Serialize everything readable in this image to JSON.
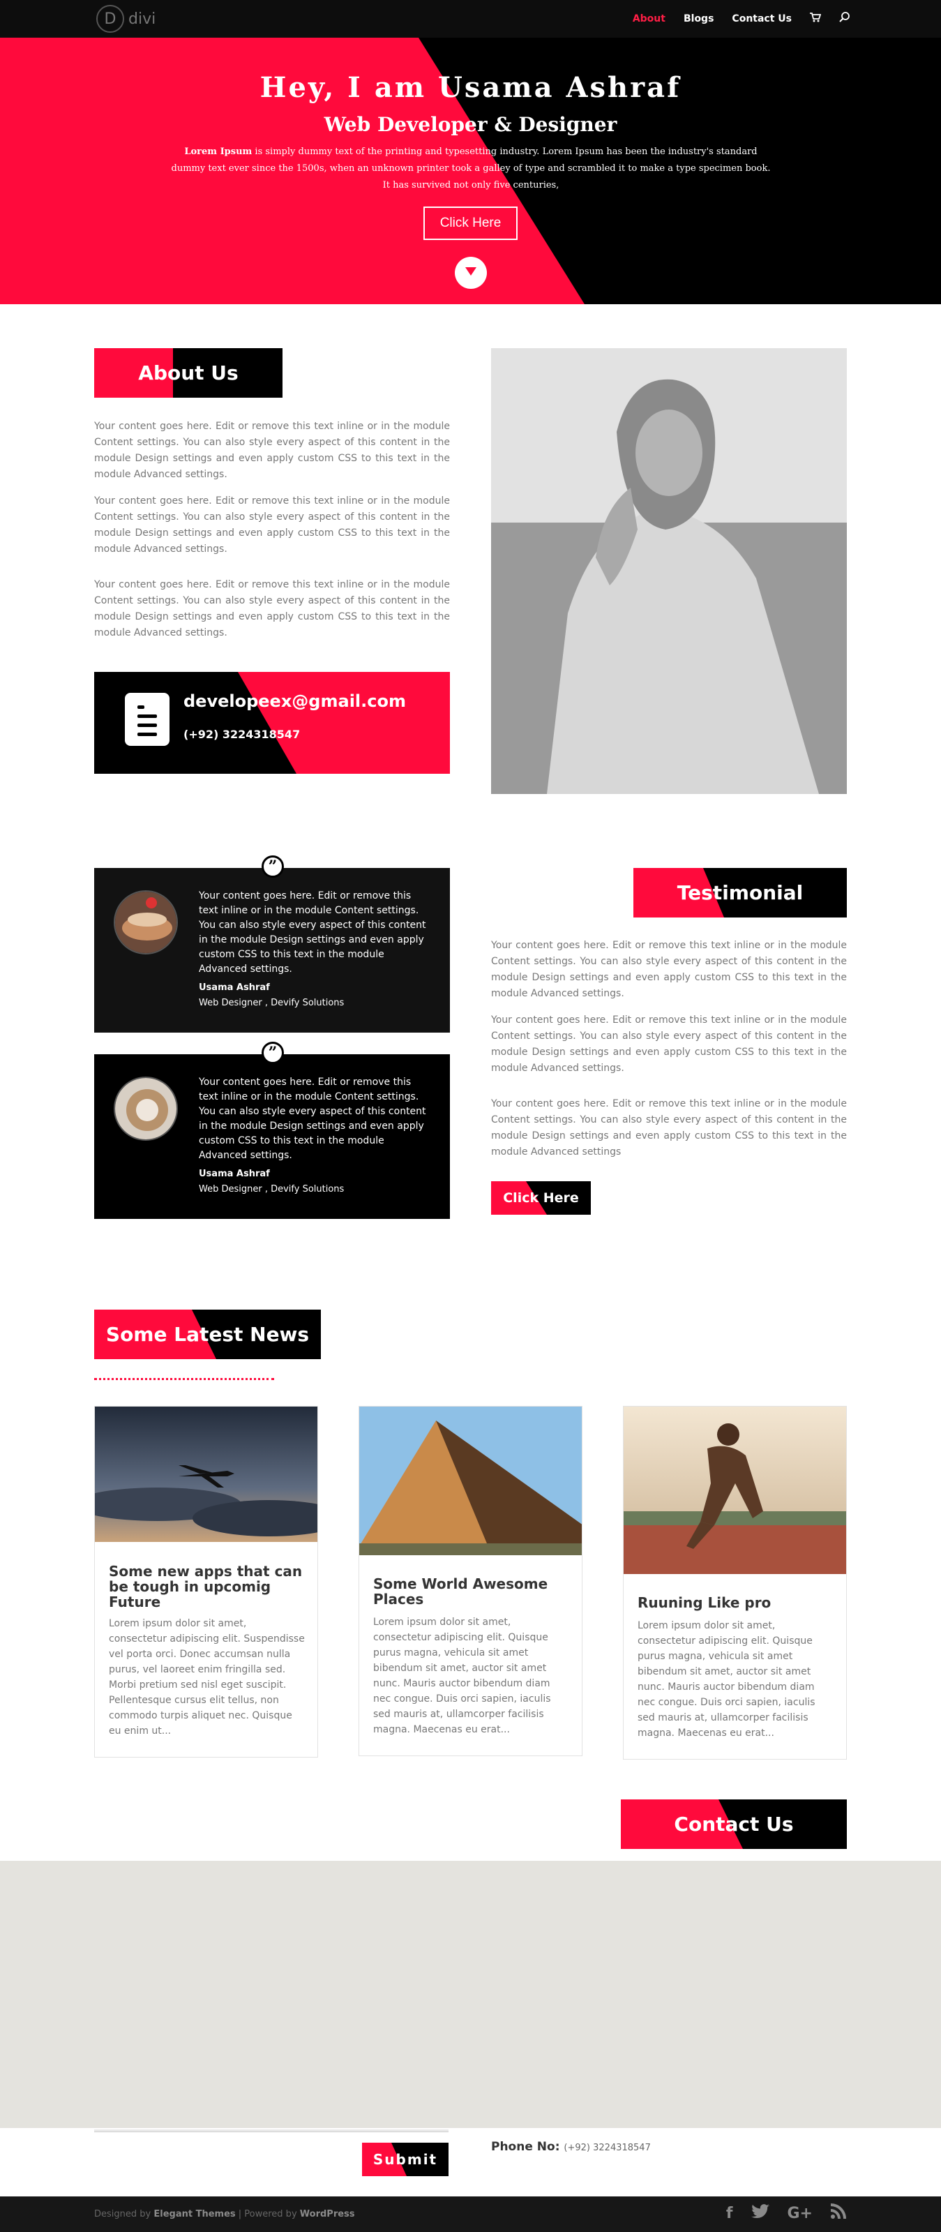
{
  "header": {
    "logo_text": "divi",
    "logo_mark": "D",
    "nav": [
      "About",
      "Blogs",
      "Contact Us"
    ],
    "cart_icon": "cart-icon",
    "search_icon": "search-icon"
  },
  "hero": {
    "title": "Hey, I am Usama Ashraf",
    "subtitle": "Web Developer & Designer",
    "text_bold": "Lorem Ipsum",
    "text": " is simply dummy text of the printing and typesetting industry. Lorem Ipsum has been the industry's standard dummy text ever since the 1500s, when an unknown printer took a galley of type and scrambled it to make a type specimen book. It has survived not only five centuries,",
    "button": "Click Here"
  },
  "about": {
    "heading": "About Us",
    "paragraphs": [
      "Your content goes here. Edit or remove this text inline or in the module Content settings. You can also style every aspect of this content in the module Design settings and even apply custom CSS to this text in the module Advanced settings.",
      "Your content goes here. Edit or remove this text inline or in the module Content settings. You can also style every aspect of this content in the module Design settings and even apply custom CSS to this text in the module Advanced settings.",
      "Your content goes here. Edit or remove this text inline or in the module Content settings. You can also style every aspect of this content in the module Design settings and even apply custom CSS to this text in the module Advanced settings."
    ],
    "email": "developeex@gmail.com",
    "phone": "(+92) 3224318547"
  },
  "testimonial": {
    "heading": "Testimonial",
    "cards": [
      {
        "text": "Your content goes here. Edit or remove this text inline or in the module Content settings. You can also style every aspect of this content in the module Design settings and even apply custom CSS to this text in the module Advanced settings.",
        "name": "Usama Ashraf",
        "role": "Web Designer , Devify Solutions"
      },
      {
        "text": "Your content goes here. Edit or remove this text inline or in the module Content settings. You can also style every aspect of this content in the module Design settings and even apply custom CSS to this text in the module Advanced settings.",
        "name": "Usama Ashraf",
        "role": "Web Designer , Devify Solutions"
      }
    ],
    "paragraphs": [
      "Your content goes here. Edit or remove this text inline or in the module Content settings. You can also style every aspect of this content in the module Design settings and even apply custom CSS to this text in the module Advanced settings.",
      "Your content goes here. Edit or remove this text inline or in the module Content settings. You can also style every aspect of this content in the module Design settings and even apply custom CSS to this text in the module Advanced settings.",
      "Your content goes here. Edit or remove this text inline or in the module Content settings. You can also style every aspect of this content in the module Design settings and even apply custom CSS to this text in the module Advanced settings"
    ],
    "button": "Click Here"
  },
  "news": {
    "heading": "Some Latest News",
    "posts": [
      {
        "title": "Some new apps that can be tough in upcomig Future",
        "text": "Lorem ipsum dolor sit amet, consectetur adipiscing elit. Suspendisse vel porta orci. Donec accumsan nulla purus, vel laoreet enim fringilla sed. Morbi pretium sed nisl eget suscipit. Pellentesque cursus elit tellus, non commodo turpis aliquet nec. Quisque eu enim ut..."
      },
      {
        "title": "Some World Awesome Places",
        "text": "Lorem ipsum dolor sit amet, consectetur adipiscing elit. Quisque purus magna, vehicula sit amet bibendum sit amet, auctor sit amet nunc. Mauris auctor bibendum diam nec congue. Duis orci sapien, iaculis sed mauris at, ullamcorper facilisis magna. Maecenas eu erat..."
      },
      {
        "title": "Ruuning Like pro",
        "text": "Lorem ipsum dolor sit amet, consectetur adipiscing elit. Quisque purus magna, vehicula sit amet bibendum sit amet, auctor sit amet nunc. Mauris auctor bibendum diam nec congue. Duis orci sapien, iaculis sed mauris at, ullamcorper facilisis magna. Maecenas eu erat..."
      }
    ]
  },
  "contact": {
    "heading": "Contact Us",
    "submit": "Submit",
    "phone_label": "Phone No:",
    "phone": "(+92) 3224318547"
  },
  "footer": {
    "designed_by": "Designed by ",
    "elegant": "Elegant Themes",
    "powered": " | Powered by ",
    "wordpress": "WordPress",
    "social": [
      "f",
      "t",
      "G+",
      "rss"
    ]
  },
  "colors": {
    "accent": "#ff0a3c",
    "nav_active": "#ff1e45",
    "dark": "#000000"
  }
}
